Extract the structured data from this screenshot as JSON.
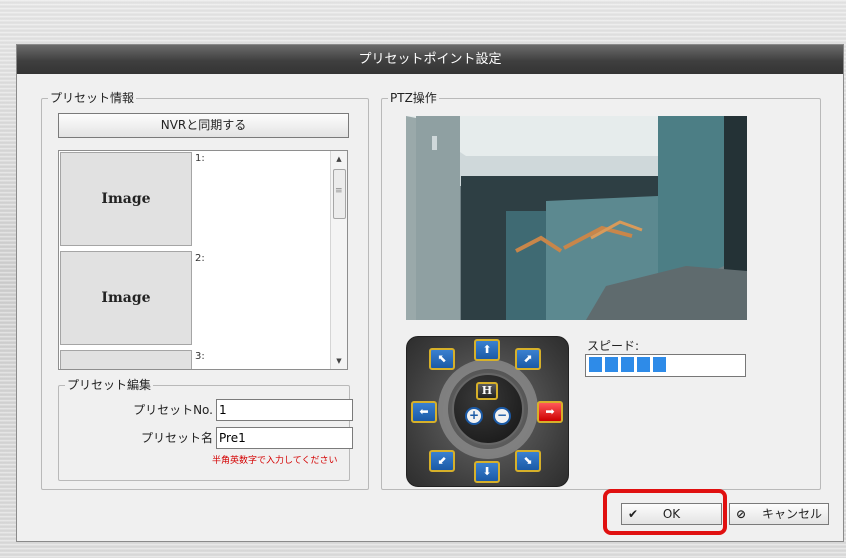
{
  "dialog": {
    "title": "プリセットポイント設定"
  },
  "preset_info": {
    "legend": "プリセット情報",
    "sync_button": "NVRと同期する",
    "items": [
      {
        "number": "1:",
        "thumb": "Image"
      },
      {
        "number": "2:",
        "thumb": "Image"
      },
      {
        "number": "3:",
        "thumb": ""
      }
    ]
  },
  "preset_edit": {
    "legend": "プリセット編集",
    "number_label": "プリセットNo.",
    "number_value": "1",
    "name_label": "プリセット名",
    "name_value": "Pre1",
    "hint": "半角英数字で入力してください"
  },
  "ptz": {
    "legend": "PTZ操作",
    "speed_label": "スピード:",
    "speed_level": 5,
    "speed_color": "#2e8be8",
    "home_label": "H"
  },
  "footer": {
    "ok_label": "OK",
    "cancel_label": "キャンセル",
    "highlight_color": "#e01010"
  }
}
